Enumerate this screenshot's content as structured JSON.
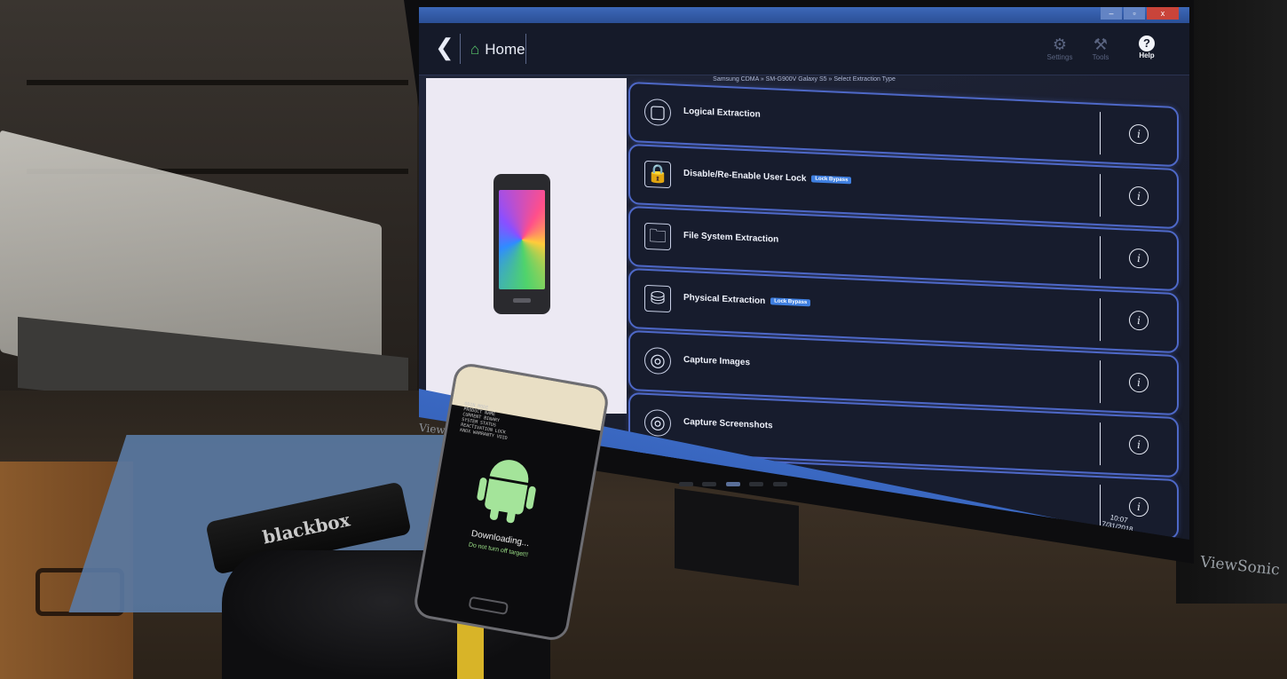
{
  "window": {
    "title_bar_text": "",
    "controls": [
      "–",
      "▫",
      "x"
    ]
  },
  "header": {
    "back_icon": "chevron-left-icon",
    "home_label": "Home",
    "actions": [
      {
        "label": "Settings",
        "icon": "gear-icon"
      },
      {
        "label": "Tools",
        "icon": "tools-icon"
      },
      {
        "label": "Help",
        "icon": "help-icon"
      }
    ]
  },
  "breadcrumb": "Samsung CDMA » SM-G900V Galaxy S5 » Select Extraction Type",
  "extraction_options": [
    {
      "label": "Logical Extraction",
      "icon": "cube-icon",
      "badge": ""
    },
    {
      "label": "Disable/Re-Enable User Lock",
      "icon": "padlock-icon",
      "badge": "Lock Bypass"
    },
    {
      "label": "File System Extraction",
      "icon": "folder-gear-icon",
      "badge": ""
    },
    {
      "label": "Physical Extraction",
      "icon": "database-lock-icon",
      "badge": "Lock Bypass"
    },
    {
      "label": "Capture Images",
      "icon": "fingerprint-camera-icon",
      "badge": ""
    },
    {
      "label": "Capture Screenshots",
      "icon": "fingerprint-phone-icon",
      "badge": ""
    },
    {
      "label": "",
      "icon": "",
      "badge": ""
    }
  ],
  "taskbar": {
    "time": "10:07",
    "date": "7/31/2018"
  },
  "phone_screen": {
    "status": "Downloading...",
    "warning": "Do not turn off target!!"
  },
  "brands": {
    "monitor": "ViewSonic",
    "right_monitor": "ViewSonic",
    "dongle": "blackbox"
  },
  "colors": {
    "row_border": "#4e68c7",
    "app_background": "#1b1f30",
    "accent_badge": "#3f7fe0",
    "android_green": "#a4e49a",
    "taskbar": "#3a68c2"
  }
}
